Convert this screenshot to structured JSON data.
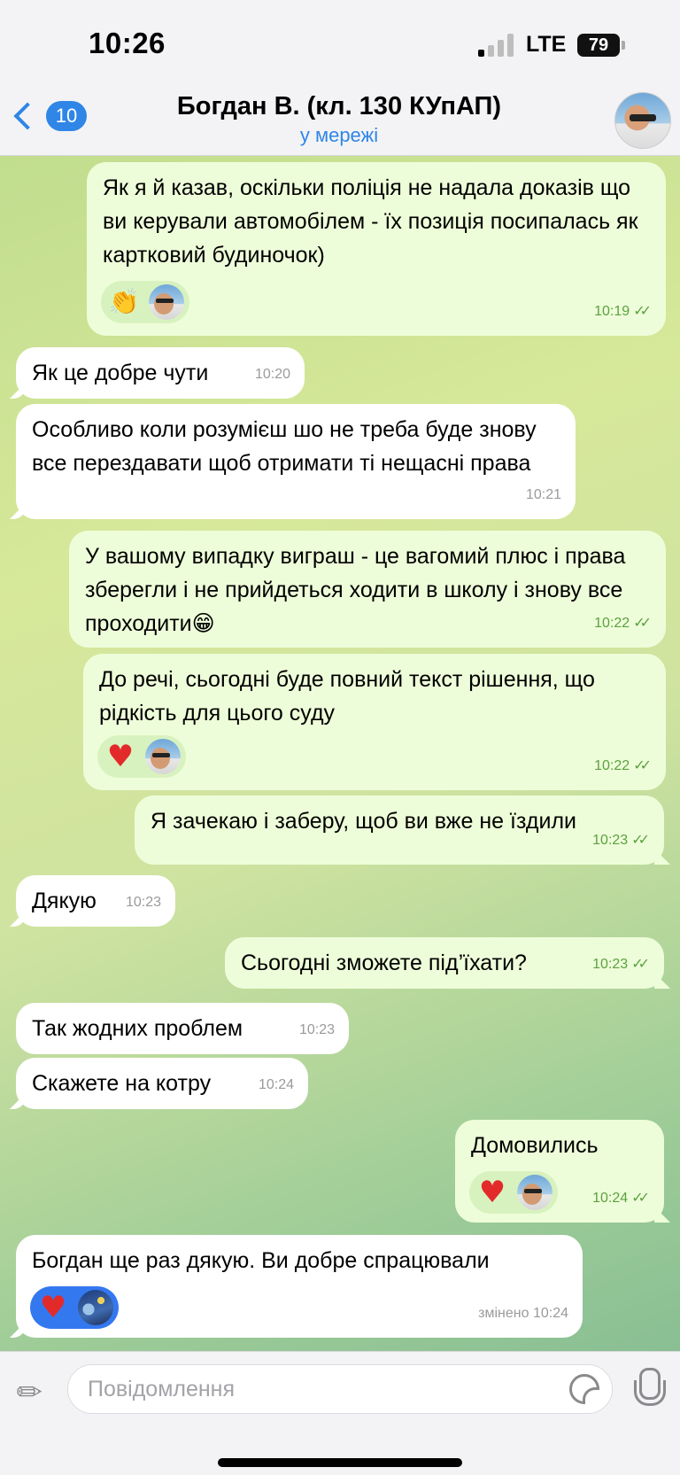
{
  "status_bar": {
    "time": "10:26",
    "network": "LTE",
    "battery": "79"
  },
  "header": {
    "back_count": "10",
    "title": "Богдан В. (кл. 130 КУпАП)",
    "status": "у мережі"
  },
  "messages": [
    {
      "side": "out",
      "text": "Як я й казав, оскільки поліція не надала доказів що ви керували автомобілем - їх позиція посипалась як картковий будиночок)",
      "time": "10:19",
      "reactions": [
        "clapping-hands",
        "contact-avatar"
      ]
    },
    {
      "side": "in",
      "text": "Як це добре чути",
      "time": "10:20"
    },
    {
      "side": "in",
      "text": "Особливо коли розумієш шо не треба буде знову все перездавати щоб отримати ті нещасні права",
      "time": "10:21"
    },
    {
      "side": "out",
      "text": "У вашому випадку виграш - це вагомий плюс і права зберегли і не прийдеться ходити в школу і знову все проходити😁",
      "time": "10:22"
    },
    {
      "side": "out",
      "text": "До речі, сьогодні буде повний текст рішення, що рідкість для цього суду",
      "time": "10:22",
      "reactions": [
        "heart",
        "contact-avatar"
      ]
    },
    {
      "side": "out",
      "text": "Я зачекаю і заберу, щоб ви вже не їздили",
      "time": "10:23"
    },
    {
      "side": "in",
      "text": "Дякую",
      "time": "10:23"
    },
    {
      "side": "out",
      "text": "Сьогодні зможете під’їхати?",
      "time": "10:23"
    },
    {
      "side": "in",
      "text": "Так жодних проблем",
      "time": "10:23"
    },
    {
      "side": "in",
      "text": "Скажете на котру",
      "time": "10:24"
    },
    {
      "side": "out",
      "text": "Домовились",
      "time": "10:24",
      "reactions": [
        "heart",
        "contact-avatar"
      ]
    },
    {
      "side": "in",
      "text": "Богдан ще раз дякую. Ви добре спрацювали",
      "time": "змінено 10:24",
      "reactions": [
        "heart",
        "my-avatar"
      ]
    }
  ],
  "input": {
    "placeholder": "Повідомлення"
  },
  "icons": [
    "back-chevron-icon",
    "attach-icon",
    "sticker-icon",
    "mic-icon",
    "read-ticks-icon"
  ],
  "colors": {
    "accent": "#2f86e6",
    "outgoing_bubble": "#eefdd9",
    "incoming_bubble": "#ffffff",
    "ticks": "#5aa23e"
  }
}
